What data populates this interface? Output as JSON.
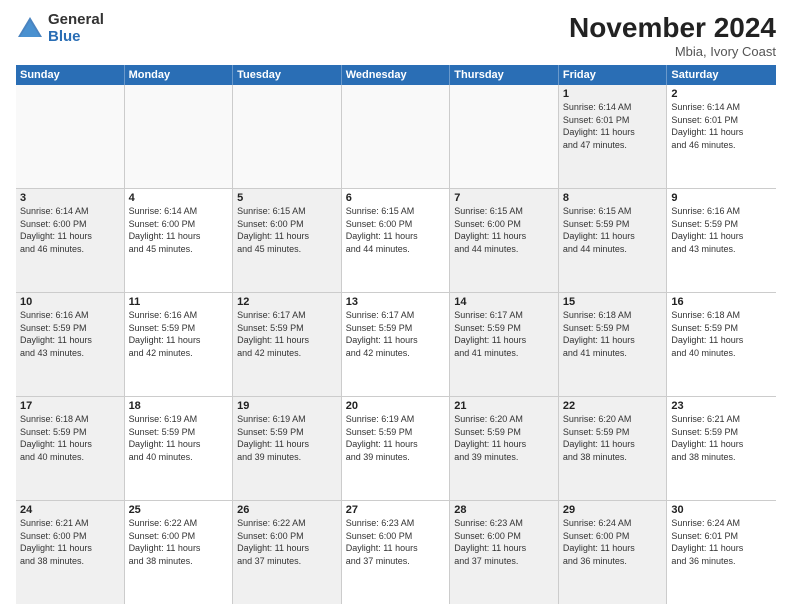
{
  "header": {
    "logo_general": "General",
    "logo_blue": "Blue",
    "title": "November 2024",
    "location": "Mbia, Ivory Coast"
  },
  "days_of_week": [
    "Sunday",
    "Monday",
    "Tuesday",
    "Wednesday",
    "Thursday",
    "Friday",
    "Saturday"
  ],
  "rows": [
    [
      {
        "day": "",
        "empty": true
      },
      {
        "day": "",
        "empty": true
      },
      {
        "day": "",
        "empty": true
      },
      {
        "day": "",
        "empty": true
      },
      {
        "day": "",
        "empty": true
      },
      {
        "day": "1",
        "lines": [
          "Sunrise: 6:14 AM",
          "Sunset: 6:01 PM",
          "Daylight: 11 hours",
          "and 47 minutes."
        ],
        "shaded": true
      },
      {
        "day": "2",
        "lines": [
          "Sunrise: 6:14 AM",
          "Sunset: 6:01 PM",
          "Daylight: 11 hours",
          "and 46 minutes."
        ]
      }
    ],
    [
      {
        "day": "3",
        "lines": [
          "Sunrise: 6:14 AM",
          "Sunset: 6:00 PM",
          "Daylight: 11 hours",
          "and 46 minutes."
        ],
        "shaded": true
      },
      {
        "day": "4",
        "lines": [
          "Sunrise: 6:14 AM",
          "Sunset: 6:00 PM",
          "Daylight: 11 hours",
          "and 45 minutes."
        ]
      },
      {
        "day": "5",
        "lines": [
          "Sunrise: 6:15 AM",
          "Sunset: 6:00 PM",
          "Daylight: 11 hours",
          "and 45 minutes."
        ],
        "shaded": true
      },
      {
        "day": "6",
        "lines": [
          "Sunrise: 6:15 AM",
          "Sunset: 6:00 PM",
          "Daylight: 11 hours",
          "and 44 minutes."
        ]
      },
      {
        "day": "7",
        "lines": [
          "Sunrise: 6:15 AM",
          "Sunset: 6:00 PM",
          "Daylight: 11 hours",
          "and 44 minutes."
        ],
        "shaded": true
      },
      {
        "day": "8",
        "lines": [
          "Sunrise: 6:15 AM",
          "Sunset: 5:59 PM",
          "Daylight: 11 hours",
          "and 44 minutes."
        ],
        "shaded": true
      },
      {
        "day": "9",
        "lines": [
          "Sunrise: 6:16 AM",
          "Sunset: 5:59 PM",
          "Daylight: 11 hours",
          "and 43 minutes."
        ]
      }
    ],
    [
      {
        "day": "10",
        "lines": [
          "Sunrise: 6:16 AM",
          "Sunset: 5:59 PM",
          "Daylight: 11 hours",
          "and 43 minutes."
        ],
        "shaded": true
      },
      {
        "day": "11",
        "lines": [
          "Sunrise: 6:16 AM",
          "Sunset: 5:59 PM",
          "Daylight: 11 hours",
          "and 42 minutes."
        ]
      },
      {
        "day": "12",
        "lines": [
          "Sunrise: 6:17 AM",
          "Sunset: 5:59 PM",
          "Daylight: 11 hours",
          "and 42 minutes."
        ],
        "shaded": true
      },
      {
        "day": "13",
        "lines": [
          "Sunrise: 6:17 AM",
          "Sunset: 5:59 PM",
          "Daylight: 11 hours",
          "and 42 minutes."
        ]
      },
      {
        "day": "14",
        "lines": [
          "Sunrise: 6:17 AM",
          "Sunset: 5:59 PM",
          "Daylight: 11 hours",
          "and 41 minutes."
        ],
        "shaded": true
      },
      {
        "day": "15",
        "lines": [
          "Sunrise: 6:18 AM",
          "Sunset: 5:59 PM",
          "Daylight: 11 hours",
          "and 41 minutes."
        ],
        "shaded": true
      },
      {
        "day": "16",
        "lines": [
          "Sunrise: 6:18 AM",
          "Sunset: 5:59 PM",
          "Daylight: 11 hours",
          "and 40 minutes."
        ]
      }
    ],
    [
      {
        "day": "17",
        "lines": [
          "Sunrise: 6:18 AM",
          "Sunset: 5:59 PM",
          "Daylight: 11 hours",
          "and 40 minutes."
        ],
        "shaded": true
      },
      {
        "day": "18",
        "lines": [
          "Sunrise: 6:19 AM",
          "Sunset: 5:59 PM",
          "Daylight: 11 hours",
          "and 40 minutes."
        ]
      },
      {
        "day": "19",
        "lines": [
          "Sunrise: 6:19 AM",
          "Sunset: 5:59 PM",
          "Daylight: 11 hours",
          "and 39 minutes."
        ],
        "shaded": true
      },
      {
        "day": "20",
        "lines": [
          "Sunrise: 6:19 AM",
          "Sunset: 5:59 PM",
          "Daylight: 11 hours",
          "and 39 minutes."
        ]
      },
      {
        "day": "21",
        "lines": [
          "Sunrise: 6:20 AM",
          "Sunset: 5:59 PM",
          "Daylight: 11 hours",
          "and 39 minutes."
        ],
        "shaded": true
      },
      {
        "day": "22",
        "lines": [
          "Sunrise: 6:20 AM",
          "Sunset: 5:59 PM",
          "Daylight: 11 hours",
          "and 38 minutes."
        ],
        "shaded": true
      },
      {
        "day": "23",
        "lines": [
          "Sunrise: 6:21 AM",
          "Sunset: 5:59 PM",
          "Daylight: 11 hours",
          "and 38 minutes."
        ]
      }
    ],
    [
      {
        "day": "24",
        "lines": [
          "Sunrise: 6:21 AM",
          "Sunset: 6:00 PM",
          "Daylight: 11 hours",
          "and 38 minutes."
        ],
        "shaded": true
      },
      {
        "day": "25",
        "lines": [
          "Sunrise: 6:22 AM",
          "Sunset: 6:00 PM",
          "Daylight: 11 hours",
          "and 38 minutes."
        ]
      },
      {
        "day": "26",
        "lines": [
          "Sunrise: 6:22 AM",
          "Sunset: 6:00 PM",
          "Daylight: 11 hours",
          "and 37 minutes."
        ],
        "shaded": true
      },
      {
        "day": "27",
        "lines": [
          "Sunrise: 6:23 AM",
          "Sunset: 6:00 PM",
          "Daylight: 11 hours",
          "and 37 minutes."
        ]
      },
      {
        "day": "28",
        "lines": [
          "Sunrise: 6:23 AM",
          "Sunset: 6:00 PM",
          "Daylight: 11 hours",
          "and 37 minutes."
        ],
        "shaded": true
      },
      {
        "day": "29",
        "lines": [
          "Sunrise: 6:24 AM",
          "Sunset: 6:00 PM",
          "Daylight: 11 hours",
          "and 36 minutes."
        ],
        "shaded": true
      },
      {
        "day": "30",
        "lines": [
          "Sunrise: 6:24 AM",
          "Sunset: 6:01 PM",
          "Daylight: 11 hours",
          "and 36 minutes."
        ]
      }
    ]
  ]
}
